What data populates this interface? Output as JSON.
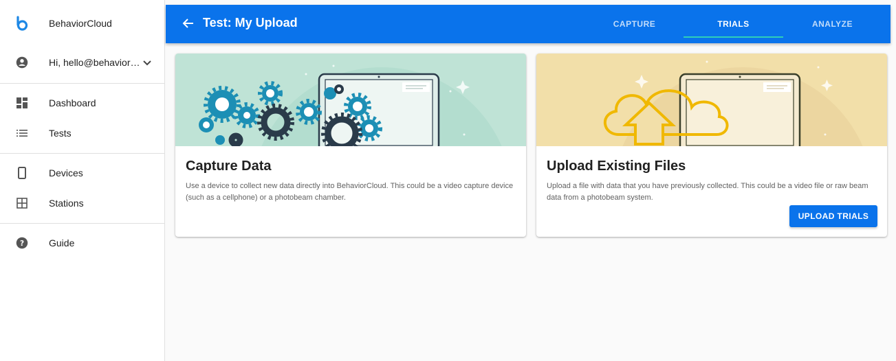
{
  "sidebar": {
    "brand": "BehaviorCloud",
    "user_greeting": "Hi, hello@behaviorcloud.com",
    "items": [
      {
        "label": "Dashboard",
        "icon": "dashboard-icon"
      },
      {
        "label": "Tests",
        "icon": "list-icon"
      },
      {
        "label": "Devices",
        "icon": "phone-icon"
      },
      {
        "label": "Stations",
        "icon": "grid-icon"
      },
      {
        "label": "Guide",
        "icon": "help-icon"
      }
    ]
  },
  "header": {
    "title": "Test: My Upload",
    "tabs": [
      {
        "label": "CAPTURE"
      },
      {
        "label": "TRIALS",
        "active": true
      },
      {
        "label": "ANALYZE"
      }
    ]
  },
  "cards": {
    "capture": {
      "title": "Capture Data",
      "text": "Use a device to collect new data directly into BehaviorCloud. This could be a video capture device (such as a cellphone) or a photobeam chamber."
    },
    "upload": {
      "title": "Upload Existing Files",
      "text": "Upload a file with data that you have previously collected. This could be a video file or raw beam data from a photobeam system.",
      "button_label": "UPLOAD TRIALS"
    }
  },
  "colors": {
    "primary": "#0a73eb",
    "tab_indicator": "#2ecfb8",
    "capture_bg": "#bfe3d6",
    "upload_bg": "#f2dfa9",
    "gear": "#1c8fb5",
    "gear_dark": "#2a3b4a",
    "cloud": "#f0b800"
  }
}
